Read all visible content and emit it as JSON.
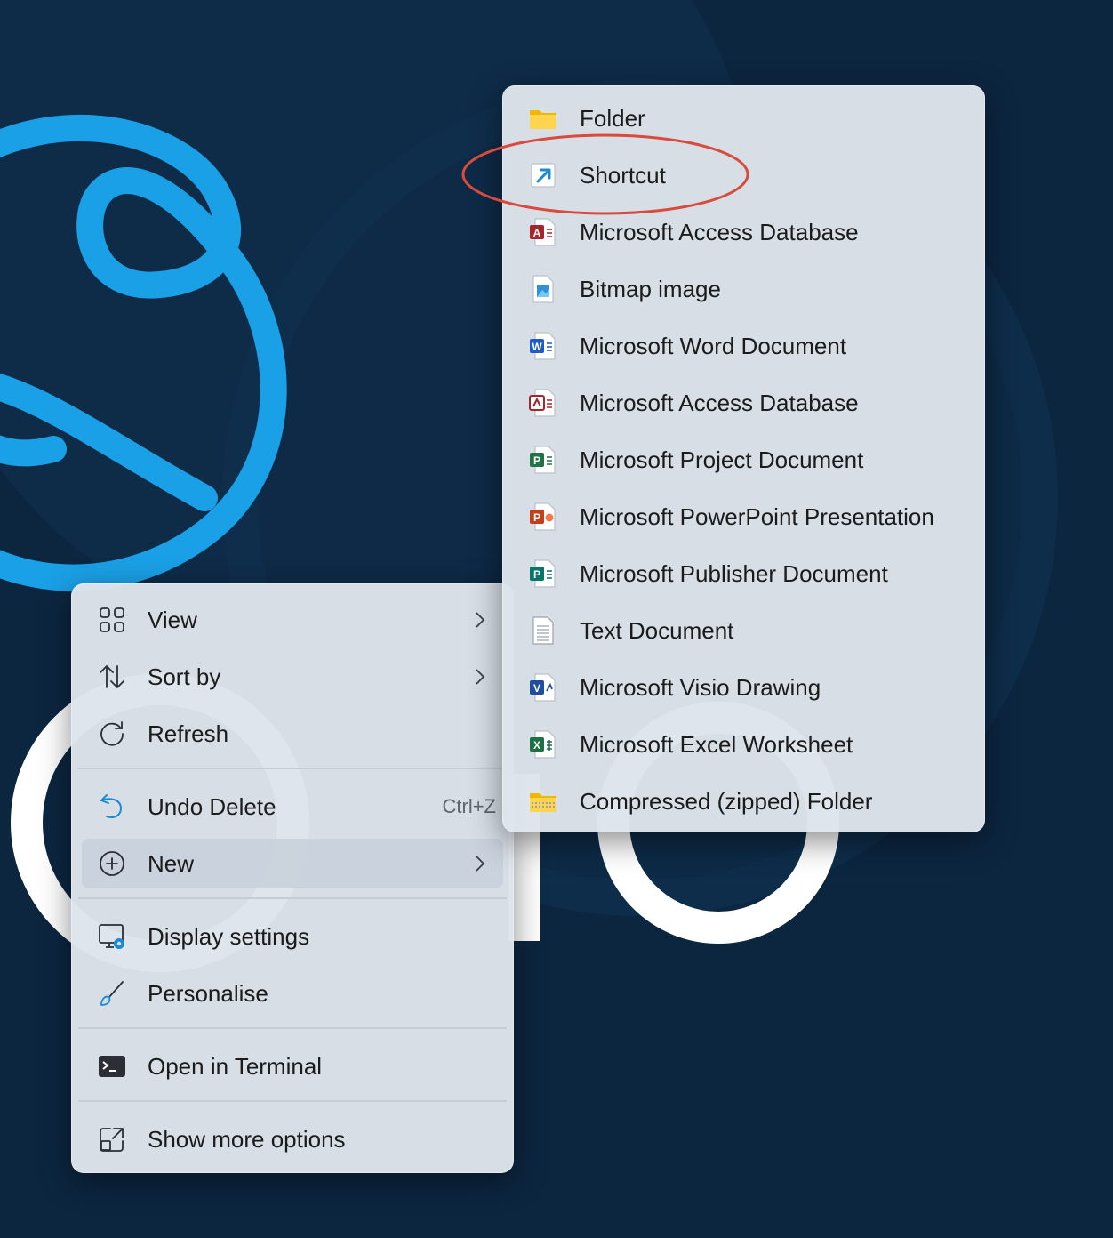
{
  "context_menu": {
    "items": [
      {
        "label": "View",
        "icon": "view-grid-icon"
      },
      {
        "label": "Sort by",
        "icon": "sort-icon"
      },
      {
        "label": "Refresh",
        "icon": "refresh-icon"
      },
      {
        "label": "Undo Delete",
        "shortcut": "Ctrl+Z",
        "icon": "undo-icon"
      },
      {
        "label": "New",
        "icon": "new-plus-icon",
        "highlighted": true
      },
      {
        "label": "Display settings",
        "icon": "display-settings-icon"
      },
      {
        "label": "Personalise",
        "icon": "brush-icon"
      },
      {
        "label": "Open in Terminal",
        "icon": "terminal-icon"
      },
      {
        "label": "Show more options",
        "icon": "show-more-options-icon"
      }
    ]
  },
  "new_submenu": {
    "items": [
      {
        "label": "Folder",
        "icon": "folder-icon"
      },
      {
        "label": "Shortcut",
        "icon": "shortcut-icon",
        "annotated": true
      },
      {
        "label": "Microsoft Access Database",
        "icon": "access-icon"
      },
      {
        "label": "Bitmap image",
        "icon": "bitmap-icon"
      },
      {
        "label": "Microsoft Word Document",
        "icon": "word-icon"
      },
      {
        "label": "Microsoft Access Database",
        "icon": "access-alt-icon"
      },
      {
        "label": "Microsoft Project Document",
        "icon": "project-icon"
      },
      {
        "label": "Microsoft PowerPoint Presentation",
        "icon": "powerpoint-icon"
      },
      {
        "label": "Microsoft Publisher Document",
        "icon": "publisher-icon"
      },
      {
        "label": "Text Document",
        "icon": "text-document-icon"
      },
      {
        "label": "Microsoft Visio Drawing",
        "icon": "visio-icon"
      },
      {
        "label": "Microsoft Excel Worksheet",
        "icon": "excel-icon"
      },
      {
        "label": "Compressed (zipped) Folder",
        "icon": "zip-folder-icon"
      }
    ]
  },
  "colors": {
    "desktop_bg": "#0c2640",
    "logo_blue": "#1aa0e6",
    "annotation_red": "#d94b3c",
    "menu_bg": "#dee4eb"
  }
}
